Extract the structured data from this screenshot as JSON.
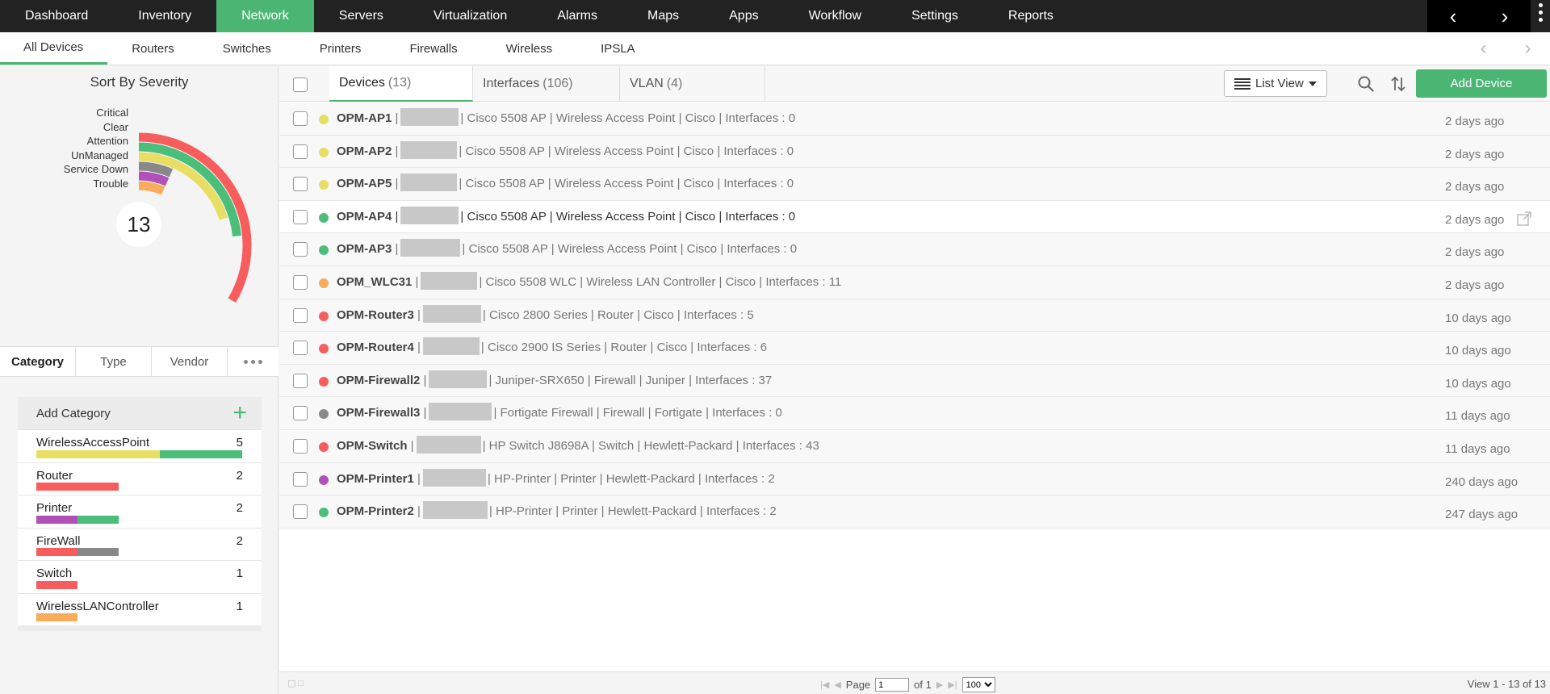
{
  "topnav": {
    "items": [
      "Dashboard",
      "Inventory",
      "Network",
      "Servers",
      "Virtualization",
      "Alarms",
      "Maps",
      "Apps",
      "Workflow",
      "Settings",
      "Reports"
    ],
    "active": "Network"
  },
  "subnav": {
    "items": [
      "All Devices",
      "Routers",
      "Switches",
      "Printers",
      "Firewalls",
      "Wireless",
      "IPSLA"
    ],
    "active": "All Devices"
  },
  "severity": {
    "title": "Sort By Severity",
    "total": "13",
    "labels": [
      "Critical",
      "Clear",
      "Attention",
      "UnManaged",
      "Service Down",
      "Trouble"
    ],
    "colors": {
      "Critical": "#f75d5d",
      "Clear": "#4bbf7a",
      "Attention": "#e8de63",
      "UnManaged": "#888888",
      "Service Down": "#b050b8",
      "Trouble": "#f8ac5a"
    },
    "counts": {
      "Critical": 4,
      "Clear": 3,
      "Attention": 3,
      "UnManaged": 1,
      "Service Down": 1,
      "Trouble": 1
    }
  },
  "category_tabs": {
    "items": [
      "Category",
      "Type",
      "Vendor"
    ],
    "active": "Category"
  },
  "categories": {
    "add_label": "Add Category",
    "rows": [
      {
        "name": "WirelessAccessPoint",
        "count": "5",
        "segments": [
          {
            "color": "#e8de63",
            "count": 3
          },
          {
            "color": "#4bbf7a",
            "count": 2
          }
        ]
      },
      {
        "name": "Router",
        "count": "2",
        "segments": [
          {
            "color": "#f75d5d",
            "count": 2
          }
        ]
      },
      {
        "name": "Printer",
        "count": "2",
        "segments": [
          {
            "color": "#b050b8",
            "count": 1
          },
          {
            "color": "#4bbf7a",
            "count": 1
          }
        ]
      },
      {
        "name": "FireWall",
        "count": "2",
        "segments": [
          {
            "color": "#f75d5d",
            "count": 1
          },
          {
            "color": "#888888",
            "count": 1
          }
        ]
      },
      {
        "name": "Switch",
        "count": "1",
        "segments": [
          {
            "color": "#f75d5d",
            "count": 1
          }
        ]
      },
      {
        "name": "WirelessLANController",
        "count": "1",
        "segments": [
          {
            "color": "#f8ac5a",
            "count": 1
          }
        ]
      }
    ]
  },
  "main_tabs": [
    {
      "label": "Devices",
      "count": "(13)",
      "active": true
    },
    {
      "label": "Interfaces",
      "count": "(106)",
      "active": false
    },
    {
      "label": "VLAN",
      "count": "(4)",
      "active": false
    }
  ],
  "toolbar": {
    "list_view": "List View",
    "add_device": "Add Device"
  },
  "devices": [
    {
      "name": "OPM-AP1",
      "status": "#e8de63",
      "model": "Cisco 5508 AP",
      "category": "Wireless Access Point",
      "vendor": "Cisco",
      "interfaces": "Interfaces : 0",
      "time": "2 days ago"
    },
    {
      "name": "OPM-AP2",
      "status": "#e8de63",
      "model": "Cisco 5508 AP",
      "category": "Wireless Access Point",
      "vendor": "Cisco",
      "interfaces": "Interfaces : 0",
      "time": "2 days ago"
    },
    {
      "name": "OPM-AP5",
      "status": "#e8de63",
      "model": "Cisco 5508 AP",
      "category": "Wireless Access Point",
      "vendor": "Cisco",
      "interfaces": "Interfaces : 0",
      "time": "2 days ago"
    },
    {
      "name": "OPM-AP4",
      "status": "#4bbf7a",
      "model": "Cisco 5508 AP",
      "category": "Wireless Access Point",
      "vendor": "Cisco",
      "interfaces": "Interfaces : 0",
      "time": "2 days ago",
      "hover": true
    },
    {
      "name": "OPM-AP3",
      "status": "#4bbf7a",
      "model": "Cisco 5508 AP",
      "category": "Wireless Access Point",
      "vendor": "Cisco",
      "interfaces": "Interfaces : 0",
      "time": "2 days ago"
    },
    {
      "name": "OPM_WLC31",
      "status": "#f8ac5a",
      "model": "Cisco 5508 WLC",
      "category": "Wireless LAN Controller",
      "vendor": "Cisco",
      "interfaces": "Interfaces : 11",
      "time": "2 days ago"
    },
    {
      "name": "OPM-Router3",
      "status": "#f75d5d",
      "model": "Cisco 2800 Series",
      "category": "Router",
      "vendor": "Cisco",
      "interfaces": "Interfaces : 5",
      "time": "10 days ago"
    },
    {
      "name": "OPM-Router4",
      "status": "#f75d5d",
      "model": "Cisco 2900 IS Series",
      "category": "Router",
      "vendor": "Cisco",
      "interfaces": "Interfaces : 6",
      "time": "10 days ago"
    },
    {
      "name": "OPM-Firewall2",
      "status": "#f75d5d",
      "model": "Juniper-SRX650",
      "category": "Firewall",
      "vendor": "Juniper",
      "interfaces": "Interfaces : 37",
      "time": "10 days ago"
    },
    {
      "name": "OPM-Firewall3",
      "status": "#888888",
      "model": "Fortigate Firewall",
      "category": "Firewall",
      "vendor": "Fortigate",
      "interfaces": "Interfaces : 0",
      "time": "11 days ago"
    },
    {
      "name": "OPM-Switch",
      "status": "#f75d5d",
      "model": "HP Switch J8698A",
      "category": "Switch",
      "vendor": "Hewlett-Packard",
      "interfaces": "Interfaces : 43",
      "time": "11 days ago"
    },
    {
      "name": "OPM-Printer1",
      "status": "#b050b8",
      "model": "HP-Printer",
      "category": "Printer",
      "vendor": "Hewlett-Packard",
      "interfaces": "Interfaces : 2",
      "time": "240 days ago"
    },
    {
      "name": "OPM-Printer2",
      "status": "#4bbf7a",
      "model": "HP-Printer",
      "category": "Printer",
      "vendor": "Hewlett-Packard",
      "interfaces": "Interfaces : 2",
      "time": "247 days ago"
    }
  ],
  "footer": {
    "page_label": "Page",
    "page_value": "1",
    "of_label": "of 1",
    "per_page": "100",
    "view_count": "View 1 - 13 of 13"
  }
}
